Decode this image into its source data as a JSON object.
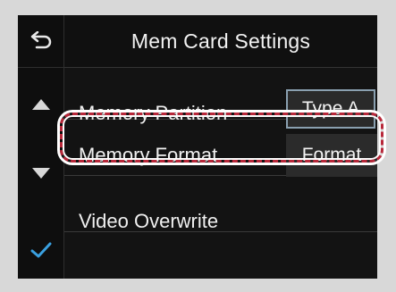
{
  "screen": {
    "title": "Mem Card Settings"
  },
  "nav": {
    "back_icon": "back-arrow-icon",
    "up_icon": "up-triangle-icon",
    "down_icon": "down-triangle-icon",
    "confirm_icon": "checkmark-icon",
    "accent_color": "#3aa0e0"
  },
  "rows": [
    {
      "label": "Memory Partition",
      "value": "Type A"
    },
    {
      "label": "Memory Format",
      "button": "Format"
    },
    {
      "label": "Video Overwrite"
    }
  ],
  "highlight": {
    "target": "Memory Format",
    "color": "#b8283a"
  }
}
